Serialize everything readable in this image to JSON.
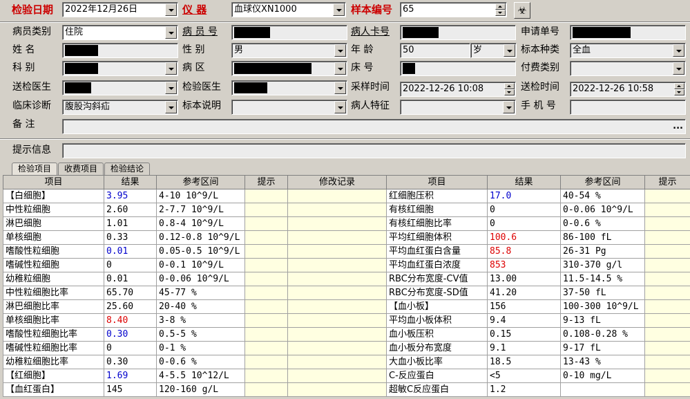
{
  "top": {
    "date_label": "检验日期",
    "date_value": "2022年12月26日",
    "instrument_label": "仪      器",
    "instrument_value": "血球仪XN1000",
    "sample_label": "样本编号",
    "sample_value": "65",
    "bio_icon": "biohazard-icon"
  },
  "form": {
    "patient_type_label": "病员类别",
    "patient_type_value": "住院",
    "patient_no_label": "病 员 号",
    "card_no_label": "病人卡号",
    "request_no_label": "申请单号",
    "name_label": "姓    名",
    "sex_label": "性    别",
    "sex_value": "男",
    "age_label": "年    龄",
    "age_value": "50",
    "age_unit": "岁",
    "specimen_label": "标本种类",
    "specimen_value": "全血",
    "dept_label": "科    别",
    "ward_label": "病    区",
    "bed_label": "床    号",
    "pay_label": "付费类别",
    "send_doctor_label": "送检医生",
    "test_doctor_label": "检验医生",
    "collect_time_label": "采样时间",
    "collect_time_value": "2022-12-26 10:08",
    "send_time_label": "送检时间",
    "send_time_value": "2022-12-26 10:58",
    "diagnosis_label": "临床诊断",
    "diagnosis_value": "腹股沟斜疝",
    "specimen_note_label": "标本说明",
    "patient_feature_label": "病人特征",
    "phone_label": "手 机 号",
    "remark_label": "备    注",
    "remark_btn": "...",
    "hint_label": "提示信息"
  },
  "tabs": [
    "检验项目",
    "收费项目",
    "检验结论"
  ],
  "left_headers": [
    "项目",
    "结果",
    "参考区间",
    "提示",
    "修改记录"
  ],
  "right_headers": [
    "项目",
    "结果",
    "参考区间",
    "提示"
  ],
  "left_rows": [
    {
      "name": "【白细胞】",
      "result": "3.95",
      "ref": "4-10 10^9/L",
      "color": "blue"
    },
    {
      "name": "中性粒细胞",
      "result": "2.60",
      "ref": "2-7.7 10^9/L",
      "color": ""
    },
    {
      "name": "淋巴细胞",
      "result": "1.01",
      "ref": "0.8-4 10^9/L",
      "color": ""
    },
    {
      "name": "单核细胞",
      "result": "0.33",
      "ref": "0.12-0.8 10^9/L",
      "color": ""
    },
    {
      "name": "嗜酸性粒细胞",
      "result": "0.01",
      "ref": "0.05-0.5 10^9/L",
      "color": "blue"
    },
    {
      "name": "嗜碱性粒细胞",
      "result": "0",
      "ref": "0-0.1 10^9/L",
      "color": ""
    },
    {
      "name": "幼稚粒细胞",
      "result": "0.01",
      "ref": "0-0.06 10^9/L",
      "color": ""
    },
    {
      "name": "中性粒细胞比率",
      "result": "65.70",
      "ref": "45-77 %",
      "color": ""
    },
    {
      "name": "淋巴细胞比率",
      "result": "25.60",
      "ref": "20-40 %",
      "color": ""
    },
    {
      "name": "单核细胞比率",
      "result": "8.40",
      "ref": "3-8 %",
      "color": "red"
    },
    {
      "name": "嗜酸性粒细胞比率",
      "result": "0.30",
      "ref": "0.5-5 %",
      "color": "blue"
    },
    {
      "name": "嗜碱性粒细胞比率",
      "result": "0",
      "ref": "0-1 %",
      "color": ""
    },
    {
      "name": "幼稚粒细胞比率",
      "result": "0.30",
      "ref": "0-0.6 %",
      "color": ""
    },
    {
      "name": "【红细胞】",
      "result": "1.69",
      "ref": "4-5.5 10^12/L",
      "color": "blue"
    },
    {
      "name": "【血红蛋白】",
      "result": "145",
      "ref": "120-160 g/L",
      "color": ""
    }
  ],
  "right_rows": [
    {
      "name": "红细胞压积",
      "result": "17.0",
      "ref": "40-54 %",
      "color": "blue"
    },
    {
      "name": "有核红细胞",
      "result": "0",
      "ref": "0-0.06 10^9/L",
      "color": ""
    },
    {
      "name": "有核红细胞比率",
      "result": "0",
      "ref": "0-0.6 %",
      "color": ""
    },
    {
      "name": "平均红细胞体积",
      "result": "100.6",
      "ref": "86-100 fL",
      "color": "red"
    },
    {
      "name": "平均血红蛋白含量",
      "result": "85.8",
      "ref": "26-31 Pg",
      "color": "red"
    },
    {
      "name": "平均血红蛋白浓度",
      "result": "853",
      "ref": "310-370 g/l",
      "color": "red"
    },
    {
      "name": "RBC分布宽度-CV值",
      "result": "13.00",
      "ref": "11.5-14.5 %",
      "color": ""
    },
    {
      "name": "RBC分布宽度-SD值",
      "result": "41.20",
      "ref": "37-50 fL",
      "color": ""
    },
    {
      "name": "【血小板】",
      "result": "156",
      "ref": "100-300 10^9/L",
      "color": ""
    },
    {
      "name": "平均血小板体积",
      "result": "9.4",
      "ref": "9-13 fL",
      "color": ""
    },
    {
      "name": "血小板压积",
      "result": "0.15",
      "ref": "0.108-0.28 %",
      "color": ""
    },
    {
      "name": "血小板分布宽度",
      "result": "9.1",
      "ref": "9-17 fL",
      "color": ""
    },
    {
      "name": "大血小板比率",
      "result": "18.5",
      "ref": "13-43 %",
      "color": ""
    },
    {
      "name": "C-反应蛋白",
      "result": "<5",
      "ref": "0-10 mg/L",
      "color": ""
    },
    {
      "name": "超敏C反应蛋白",
      "result": "1.2",
      "ref": "",
      "color": ""
    }
  ]
}
